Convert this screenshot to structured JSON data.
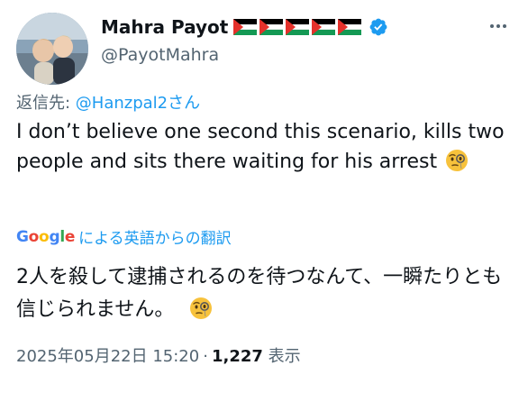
{
  "user": {
    "display_name": "Mahra Payot",
    "handle": "@PayotMahra",
    "flag_emoji_count": 5,
    "verified": true,
    "colors": {
      "verified_badge": "#1d9bf0"
    }
  },
  "reply": {
    "prefix": "返信先: ",
    "target": "@Hanzpal2さん"
  },
  "tweet": {
    "text": "I don’t believe one second this scenario, kills two people and sits there waiting for his arrest",
    "emoji": "face-with-monocle"
  },
  "translate": {
    "brand": "Google",
    "label": "による英語からの翻訳"
  },
  "translation": {
    "text": "2人を殺して逮捕されるのを待つなんて、一瞬たりとも信じられません。",
    "emoji": "face-with-monocle"
  },
  "meta": {
    "datetime": "2025年05月22日 15:20",
    "separator": "·",
    "views": "1,227",
    "views_label": "表示"
  },
  "colors": {
    "link": "#1d9bf0",
    "secondary_text": "#536471",
    "primary_text": "#0f1419"
  }
}
